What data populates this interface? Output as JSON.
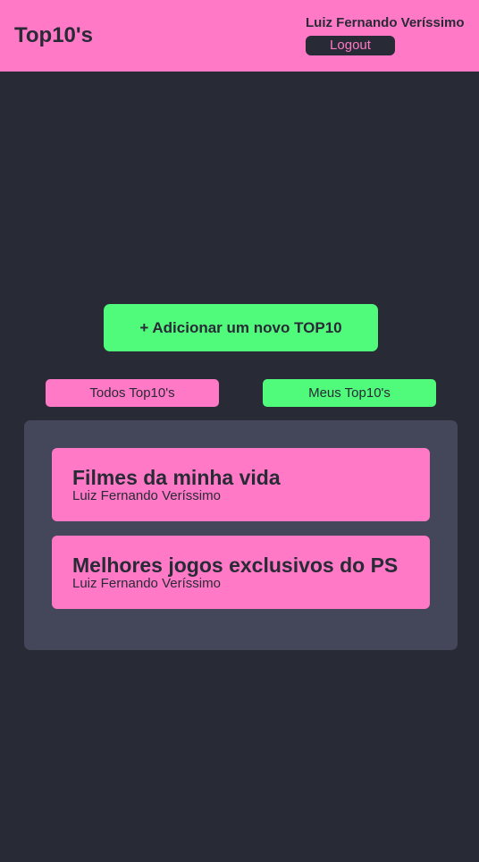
{
  "header": {
    "brand": "Top10's",
    "user_name": "Luiz Fernando Veríssimo",
    "logout_label": "Logout"
  },
  "actions": {
    "add_label": "+ Adicionar um novo TOP10"
  },
  "tabs": [
    {
      "label": "Todos Top10's"
    },
    {
      "label": "Meus Top10's",
      "active": true
    }
  ],
  "lists": [
    {
      "title": "Filmes da minha vida",
      "author": "Luiz Fernando Veríssimo"
    },
    {
      "title": "Melhores jogos exclusivos do PS",
      "author": "Luiz Fernando Veríssimo"
    }
  ],
  "colors": {
    "background": "#282a36",
    "panel": "#44475a",
    "pink": "#ff79c6",
    "green": "#50fa7b"
  }
}
